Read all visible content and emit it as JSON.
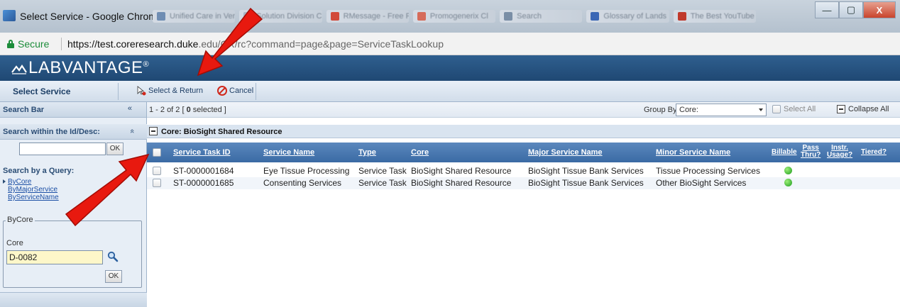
{
  "window": {
    "title": "Select Service - Google Chrome",
    "tabs": [
      {
        "label": "Unified Care in Ver",
        "color": "#6f8db3"
      },
      {
        "label": "Solution Division C",
        "color": "#a9b6c6"
      },
      {
        "label": "RMessage - Free F",
        "color": "#d24a3a"
      },
      {
        "label": "Promogenerix Cl",
        "color": "#d66b5a"
      },
      {
        "label": "Search",
        "color": "#7a8ea6"
      },
      {
        "label": "Glossary of Lands",
        "color": "#3b67b5"
      },
      {
        "label": "The Best YouTube",
        "color": "#c0392b"
      }
    ],
    "minimize": "—",
    "maximize": "▢",
    "close": "X"
  },
  "address": {
    "secure_label": "Secure",
    "host": "https://test.coreresearch.duke",
    "path": ".edu/CR/rc?command=page&page=ServiceTaskLookup"
  },
  "brand": {
    "logo_text": "LABVANTAGE",
    "trademark": "®"
  },
  "toolbar": {
    "page_title": "Select Service",
    "select_return_label": "Select & Return",
    "cancel_label": "Cancel"
  },
  "sidebar": {
    "search_bar_label": "Search Bar",
    "search_bar_collapse": "«",
    "id_search_label": "Search within the Id/Desc:",
    "id_search_collapse": "«",
    "id_search_value": "",
    "ok_label": "OK",
    "query_label": "Search by a Query:",
    "queries": [
      "ByCore",
      "ByMajorService",
      "ByServiceName"
    ],
    "bycore_legend": "ByCore",
    "core_label": "Core",
    "core_value": "D-0082",
    "core_ok_label": "OK"
  },
  "main": {
    "count_prefix": "1 - 2 of 2 [ ",
    "selected_count": "0",
    "count_suffix": " selected ]",
    "groupby_label": "Group By",
    "groupby_value": "Core:",
    "select_all_label": "Select All",
    "collapse_all_label": "Collapse All",
    "group_label": "Core: BioSight Shared Resource"
  },
  "grid": {
    "columns": {
      "service_task_id": "Service Task ID",
      "service_name": "Service Name",
      "type": "Type",
      "core": "Core",
      "major_service_name": "Major Service Name",
      "minor_service_name": "Minor Service Name",
      "billable": "Billable",
      "pass_thru_1": "Pass",
      "pass_thru_2": "Thru?",
      "instr_usage_1": "Instr.",
      "instr_usage_2": "Usage?",
      "tiered": "Tiered?"
    },
    "rows": [
      {
        "service_task_id": "ST-0000001684",
        "service_name": "Eye Tissue Processing",
        "type": "Service Task",
        "core": "BioSight Shared Resource",
        "major_service_name": "BioSight Tissue Bank Services",
        "minor_service_name": "Tissue Processing Services",
        "billable_status": "green"
      },
      {
        "service_task_id": "ST-0000001685",
        "service_name": "Consenting Services",
        "type": "Service Task",
        "core": "BioSight Shared Resource",
        "major_service_name": "BioSight Tissue Bank Services",
        "minor_service_name": "Other BioSight Services",
        "billable_status": "green"
      }
    ]
  },
  "colors": {
    "header_blue": "#1f4873",
    "grid_header_blue": "#3a6aa4",
    "annotation_red": "#e8190f",
    "billable_green": "#1c9a1c"
  }
}
